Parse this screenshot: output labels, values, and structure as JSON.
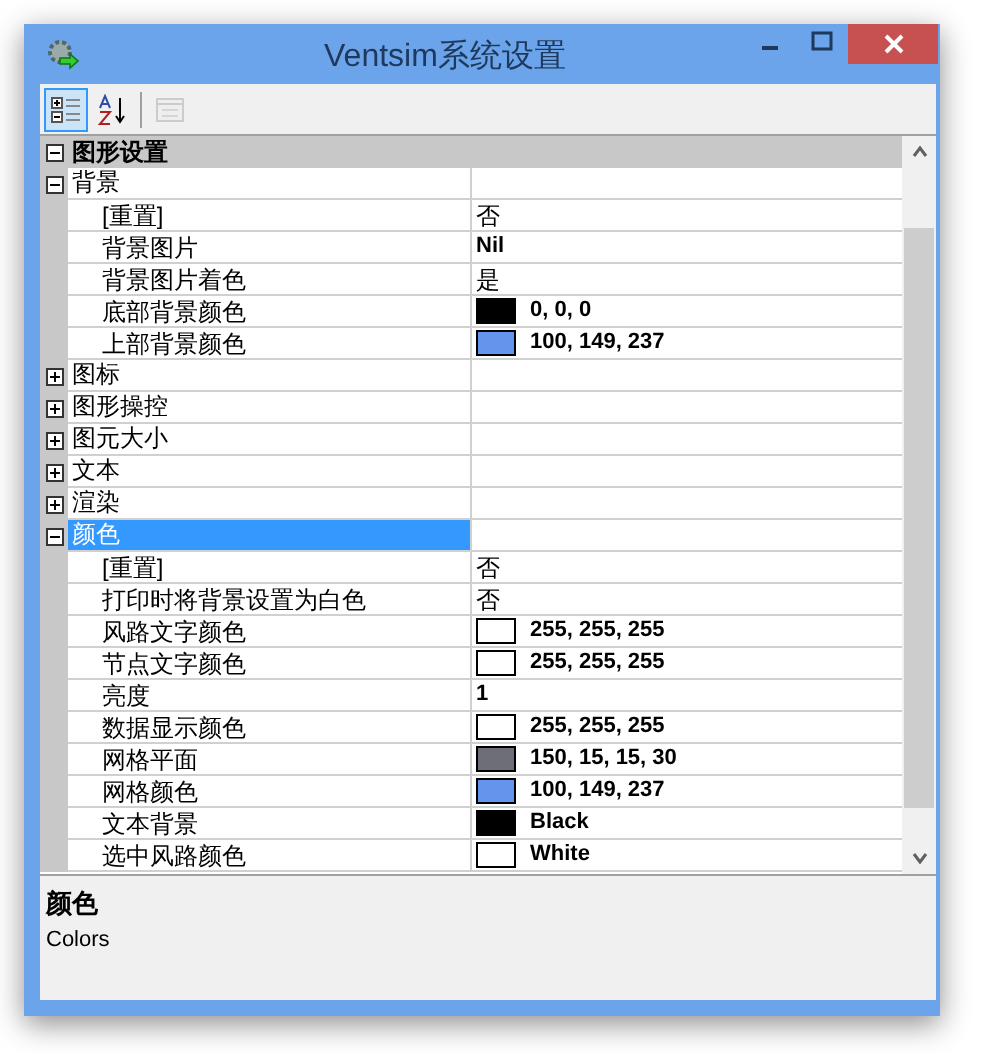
{
  "window": {
    "title": "Ventsim系统设置"
  },
  "toolbar": [
    {
      "kind": "categorized",
      "selected": true,
      "disabled": false
    },
    {
      "kind": "alphabetical",
      "selected": false,
      "disabled": false
    },
    {
      "kind": "pages",
      "selected": false,
      "disabled": true
    }
  ],
  "categories": [
    {
      "label": "图形设置",
      "expanded": true,
      "groups": [
        {
          "label": "背景",
          "expanded": true,
          "selected": false,
          "properties": [
            {
              "name": "[重置]",
              "kind": "text",
              "value": "否",
              "modified": false
            },
            {
              "name": "背景图片",
              "kind": "text",
              "value": "Nil",
              "modified": true
            },
            {
              "name": "背景图片着色",
              "kind": "text",
              "value": "是",
              "modified": false
            },
            {
              "name": "底部背景颜色",
              "kind": "color",
              "color": "#000000",
              "value": "0, 0, 0",
              "modified": true
            },
            {
              "name": "上部背景颜色",
              "kind": "color",
              "color": "#6495ed",
              "value": "100, 149, 237",
              "modified": true
            }
          ]
        },
        {
          "label": "图标",
          "expanded": false,
          "selected": false
        },
        {
          "label": "图形操控",
          "expanded": false,
          "selected": false
        },
        {
          "label": "图元大小",
          "expanded": false,
          "selected": false
        },
        {
          "label": "文本",
          "expanded": false,
          "selected": false
        },
        {
          "label": "渲染",
          "expanded": false,
          "selected": false
        },
        {
          "label": "颜色",
          "expanded": true,
          "selected": true,
          "properties": [
            {
              "name": "[重置]",
              "kind": "text",
              "value": "否",
              "modified": false
            },
            {
              "name": "打印时将背景设置为白色",
              "kind": "text",
              "value": "否",
              "modified": false
            },
            {
              "name": "风路文字颜色",
              "kind": "color",
              "color": "#ffffff",
              "value": "255, 255, 255",
              "modified": true
            },
            {
              "name": "节点文字颜色",
              "kind": "color",
              "color": "#ffffff",
              "value": "255, 255, 255",
              "modified": true
            },
            {
              "name": "亮度",
              "kind": "text",
              "value": "1",
              "modified": true
            },
            {
              "name": "数据显示颜色",
              "kind": "color",
              "color": "#ffffff",
              "value": "255, 255, 255",
              "modified": true
            },
            {
              "name": "网格平面",
              "kind": "color",
              "color": "#6e6e78",
              "value": "150, 15, 15, 30",
              "modified": true
            },
            {
              "name": "网格颜色",
              "kind": "color",
              "color": "#6495ed",
              "value": "100, 149, 237",
              "modified": true
            },
            {
              "name": "文本背景",
              "kind": "color",
              "color": "#000000",
              "value": "Black",
              "modified": true
            },
            {
              "name": "选中风路颜色",
              "kind": "color",
              "color": "#ffffff",
              "value": "White",
              "modified": true
            }
          ]
        }
      ]
    }
  ],
  "description": {
    "title": "颜色",
    "text": "Colors"
  }
}
